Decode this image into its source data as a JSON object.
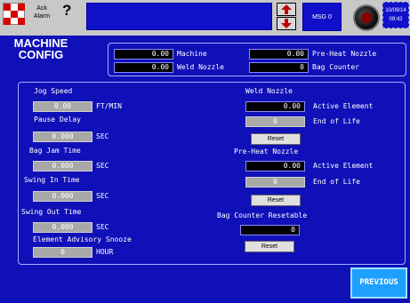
{
  "topbar": {
    "ack_line1": "Ack",
    "ack_line2": "Alarm",
    "help": "?",
    "msg": "MSG 0",
    "date": "10/09/14",
    "time": "09:42"
  },
  "title": {
    "line1": "MACHINE",
    "line2": "CONFIG"
  },
  "header": {
    "machine_value": "0.00",
    "machine_label": "Machine",
    "weld_nozzle_value": "0.00",
    "weld_nozzle_label": "Weld Nozzle",
    "preheat_nozzle_value": "0.00",
    "preheat_nozzle_label": "Pre-Heat Nozzle",
    "bag_counter_value": "0",
    "bag_counter_label": "Bag Counter"
  },
  "left": {
    "jog_speed_label": "Jog Speed",
    "jog_speed_value": "0.00",
    "jog_speed_unit": "FT/MIN",
    "pause_delay_label": "Pause Delay",
    "pause_delay_value": "0.000",
    "pause_delay_unit": "SEC",
    "bag_jam_label": "Bag Jam Time",
    "bag_jam_value": "0.000",
    "bag_jam_unit": "SEC",
    "swing_in_label": "Swing In Time",
    "swing_in_value": "0.000",
    "swing_in_unit": "SEC",
    "swing_out_label": "Swing Out Time",
    "swing_out_value": "0.000",
    "swing_out_unit": "SEC",
    "snooze_label": "Element Advisory Snooze",
    "snooze_value": "0",
    "snooze_unit": "HOUR"
  },
  "right": {
    "weld_title": "Weld Nozzle",
    "weld_active_value": "0.00",
    "weld_active_label": "Active Element",
    "weld_eol_value": "0",
    "weld_eol_label": "End of Life",
    "weld_reset": "Reset",
    "preheat_title": "Pre-Heat Nozzle",
    "preheat_active_value": "0.00",
    "preheat_active_label": "Active Element",
    "preheat_eol_value": "0",
    "preheat_eol_label": "End of Life",
    "preheat_reset": "Reset",
    "bag_reset_title": "Bag Counter Resetable",
    "bag_reset_value": "0",
    "bag_reset": "Reset"
  },
  "footer": {
    "previous": "PREVIOUS"
  },
  "colors": {
    "background": "#1010b8",
    "topbar": "#c8c8c8",
    "previous": "#1ea0ff",
    "logo_red": "#d40000"
  }
}
